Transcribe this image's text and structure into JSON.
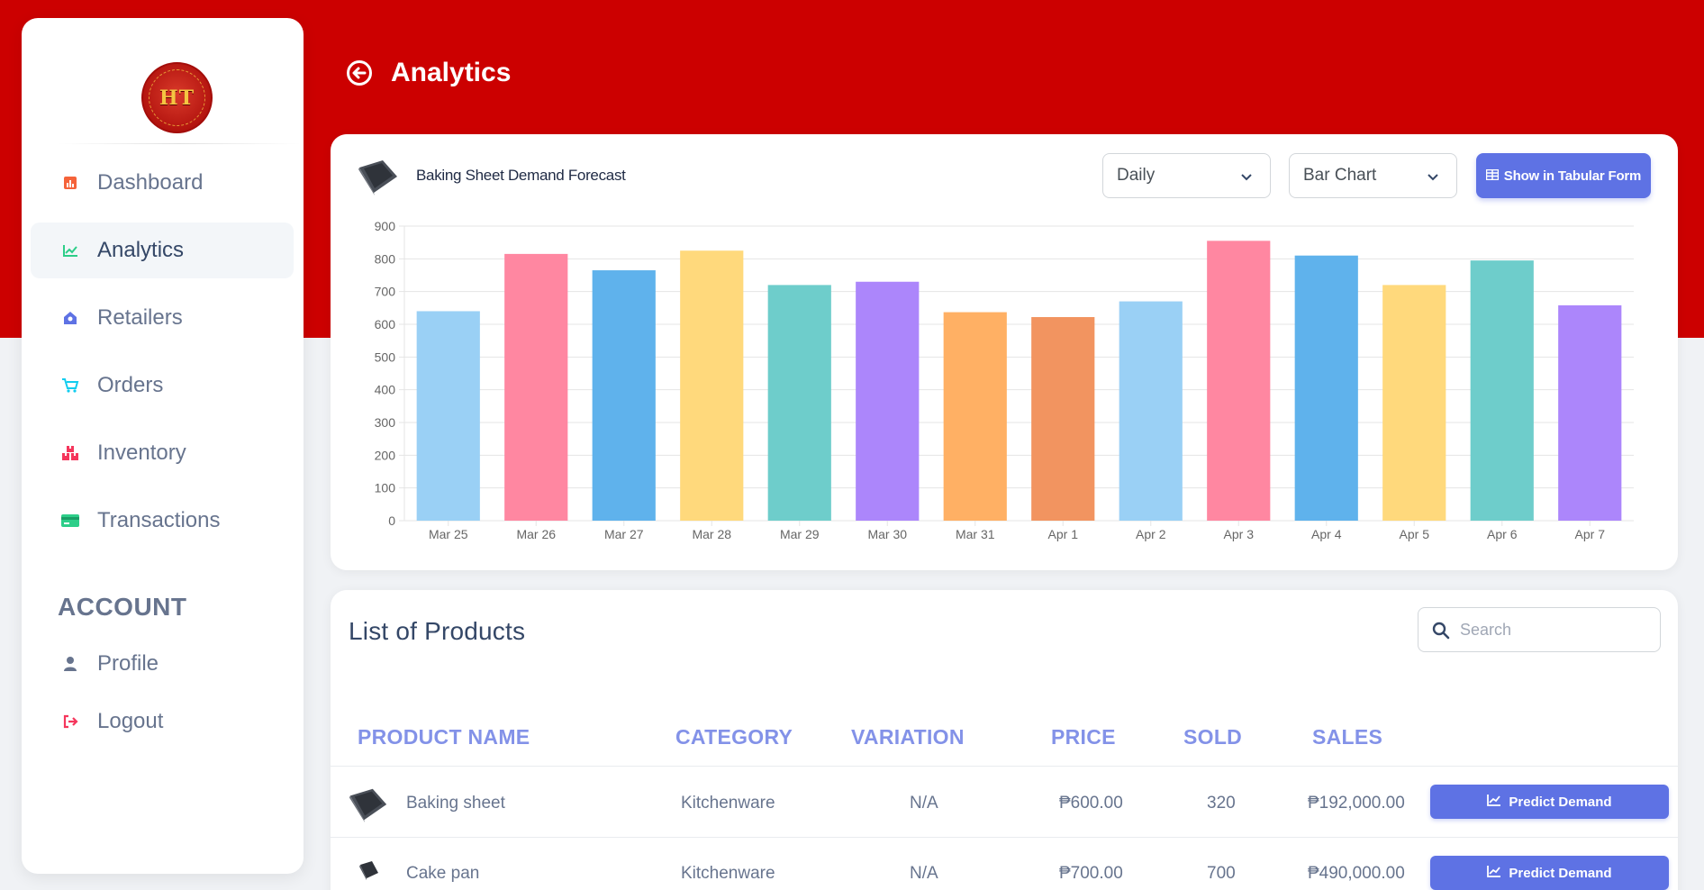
{
  "header": {
    "title": "Analytics"
  },
  "sidebar": {
    "items": [
      {
        "label": "Dashboard",
        "icon": "bar-chart-icon"
      },
      {
        "label": "Analytics",
        "icon": "line-chart-icon"
      },
      {
        "label": "Retailers",
        "icon": "store-icon"
      },
      {
        "label": "Orders",
        "icon": "cart-icon"
      },
      {
        "label": "Inventory",
        "icon": "boxes-icon"
      },
      {
        "label": "Transactions",
        "icon": "card-icon"
      }
    ],
    "account_section_title": "ACCOUNT",
    "account_items": [
      {
        "label": "Profile",
        "icon": "user-icon"
      },
      {
        "label": "Logout",
        "icon": "logout-icon"
      }
    ],
    "active_item": "Analytics"
  },
  "chart_card": {
    "title": "Baking Sheet Demand Forecast",
    "period_select": {
      "value": "Daily"
    },
    "chart_type_select": {
      "value": "Bar Chart"
    },
    "tabular_button_label": "Show in Tabular Form"
  },
  "chart_data": {
    "type": "bar",
    "title": "",
    "xlabel": "",
    "ylabel": "",
    "categories": [
      "Mar 25",
      "Mar 26",
      "Mar 27",
      "Mar 28",
      "Mar 29",
      "Mar 30",
      "Mar 31",
      "Apr 1",
      "Apr 2",
      "Apr 3",
      "Apr 4",
      "Apr 5",
      "Apr 6",
      "Apr 7"
    ],
    "values": [
      640,
      815,
      765,
      825,
      720,
      730,
      637,
      622,
      670,
      855,
      810,
      720,
      795,
      658
    ],
    "ylim": [
      0,
      900
    ],
    "yticks": [
      0,
      100,
      200,
      300,
      400,
      500,
      600,
      700,
      800,
      900
    ],
    "grid": true,
    "bar_colors": [
      "#9ad0f5",
      "#ff87a1",
      "#5fb2ec",
      "#ffd97c",
      "#6ecdcb",
      "#ac86fb",
      "#ffb064",
      "#f29460",
      "#9ad0f5",
      "#ff87a1",
      "#5fb2ec",
      "#ffd97c",
      "#6ecdcb",
      "#ac86fb"
    ]
  },
  "products": {
    "title": "List of Products",
    "search_placeholder": "Search",
    "columns": [
      "PRODUCT NAME",
      "CATEGORY",
      "VARIATION",
      "PRICE",
      "SOLD",
      "SALES"
    ],
    "rows": [
      {
        "name": "Baking sheet",
        "category": "Kitchenware",
        "variation": "N/A",
        "price": "₱600.00",
        "sold": "320",
        "sales": "₱192,000.00",
        "action": "Predict Demand"
      },
      {
        "name": "Cake pan",
        "category": "Kitchenware",
        "variation": "N/A",
        "price": "₱700.00",
        "sold": "700",
        "sales": "₱490,000.00",
        "action": "Predict Demand"
      }
    ]
  },
  "colors": {
    "brand_red": "#cc0000",
    "accent": "#5e72e4",
    "header_text": "#8392e8"
  }
}
